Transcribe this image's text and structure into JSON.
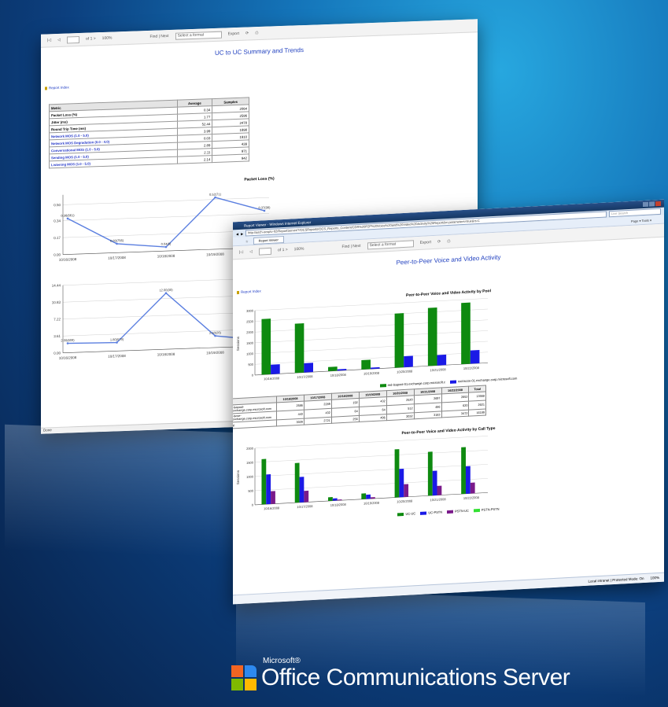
{
  "colors": {
    "accent_blue": "#1f3fbf",
    "green_series": "#0e8a10",
    "blue_series": "#1a1ae6",
    "line_color": "#5b7fe0"
  },
  "toolbar": {
    "page_of": "of 1 >",
    "zoom": "100%",
    "find_next": "Find | Next",
    "select_format": "Select a format",
    "export": "Export"
  },
  "report1": {
    "title": "UC to UC Summary and Trends",
    "report_index": "Report Index",
    "table": {
      "headers": [
        "Metric",
        "Average",
        "Samples"
      ],
      "rows": [
        [
          "Packet Loss (%)",
          "0.34",
          "2064"
        ],
        [
          "Jitter (ms)",
          "1.77",
          "2596"
        ],
        [
          "Round Trip Time (ms)",
          "52.44",
          "2478"
        ],
        [
          "Network MOS (1.0 - 5.0)",
          "3.99",
          "1898"
        ],
        [
          "Network MOS Degradation (0.0 - 4.0)",
          "0.03",
          "1910"
        ],
        [
          "Conversational MOS (1.0 - 5.0)",
          "2.89",
          "439"
        ],
        [
          "Sending MOS (1.0 - 5.0)",
          "2.11",
          "971"
        ],
        [
          "Listening MOS (1.0 - 5.0)",
          "2.14",
          "942"
        ]
      ]
    },
    "status": "Done"
  },
  "chart_data": [
    {
      "type": "line",
      "title": "Packet Loss (%)",
      "categories": [
        "10/16/2008",
        "10/17/2008",
        "10/18/2008",
        "10/19/2008",
        "10/20/2008"
      ],
      "values": [
        0.36,
        0.09,
        0.04,
        0.52,
        0.37
      ],
      "data_labels": [
        "0.36(661)",
        "0.09(756)",
        "0.04(6)",
        "0.52(71)",
        "0.37(98)"
      ],
      "yticks": [
        "0.50",
        "0.34",
        "0.17",
        "0.00"
      ],
      "ylim": [
        0,
        0.6
      ]
    },
    {
      "type": "line",
      "title": "Jitter (ms)",
      "categories": [
        "10/16/2008",
        "10/17/2008",
        "10/18/2008",
        "10/19/2008",
        "10/20/2008"
      ],
      "values": [
        2.0,
        1.8,
        12.0,
        2.5,
        1.2
      ],
      "data_labels": [
        "2.00(609)",
        "1.80(579)",
        "12.00(30)",
        "2.50(26)",
        "1.00(450)"
      ],
      "yticks": [
        "14.44",
        "10.83",
        "7.22",
        "3.61",
        "0.00"
      ],
      "ylim": [
        0,
        14.44
      ]
    },
    {
      "type": "bar",
      "title": "Peer-to-Peer Voice and Video Activity by Pool",
      "ylabel": "Sessions",
      "categories": [
        "10/16/2008",
        "10/17/2008",
        "10/18/2008",
        "10/19/2008",
        "10/20/2008",
        "10/21/2008",
        "10/22/2008"
      ],
      "series": [
        {
          "name": "red-lsapool-01.exchange.corp.microsoft.c",
          "values": [
            2586,
            2289,
            192,
            432,
            2520,
            2697,
            2852
          ]
        },
        {
          "name": "red-lscse-01.exchange.corp.microsoft.com",
          "values": [
            443,
            432,
            64,
            64,
            512,
            486,
            620
          ]
        }
      ],
      "yticks": [
        "3000",
        "2500",
        "2000",
        "1500",
        "1000",
        "500",
        "0"
      ],
      "ylim": [
        0,
        3000
      ]
    },
    {
      "type": "bar",
      "title": "Peer-to-Peer Voice and Video Activity by Call Type",
      "ylabel": "Sessions",
      "categories": [
        "10/16/2008",
        "10/17/2008",
        "10/18/2008",
        "10/19/2008",
        "10/20/2008",
        "10/21/2008",
        "10/22/2008"
      ],
      "series": [
        {
          "name": "UC-UC",
          "values": [
            1600,
            1400,
            130,
            200,
            1700,
            1550,
            1650
          ]
        },
        {
          "name": "UC-PSTN",
          "values": [
            1050,
            900,
            80,
            150,
            1000,
            870,
            970
          ]
        },
        {
          "name": "PSTN-UC",
          "values": [
            450,
            400,
            30,
            50,
            450,
            330,
            380
          ]
        },
        {
          "name": "PSTN-PSTN",
          "values": [
            0,
            0,
            0,
            0,
            0,
            0,
            0
          ]
        }
      ],
      "yticks": [
        "2000",
        "1500",
        "1000",
        "500",
        "0"
      ],
      "ylim": [
        0,
        2000
      ]
    }
  ],
  "report2": {
    "window_title": "Report Viewer - Windows Internet Explorer",
    "url": "http://asch-ocsptv-02/ReportServer/?/OCSReports/OCS_Reports_Content/CDR%20P2P%20Voice%20and%20Video%20Activity%20Report&rc:parameters=true&rs:C",
    "search_placeholder": "Live Search",
    "tab_label": "Report Viewer",
    "tools": "Page ▾ Tools ▾",
    "title": "Peer-to-Peer Voice and Video Activity",
    "report_index": "Report Index",
    "table": {
      "headers": [
        "",
        "10/16/2008",
        "10/17/2008",
        "10/18/2008",
        "10/19/2008",
        "10/20/2008",
        "10/21/2008",
        "10/22/2008",
        "Total"
      ],
      "rows": [
        [
          "red-lsapool-01.exchange.corp.microsoft.com",
          "2586",
          "2289",
          "192",
          "432",
          "2520",
          "2697",
          "2852",
          "13568"
        ],
        [
          "red-lscse-01.exchange.corp.microsoft.com",
          "443",
          "432",
          "64",
          "64",
          "512",
          "486",
          "620",
          "2621"
        ],
        [
          "Total",
          "3029",
          "2721",
          "256",
          "496",
          "3032",
          "3183",
          "3472",
          "16189"
        ]
      ]
    },
    "status_zone": "Local intranet | Protected Mode: On",
    "status_zoom": "100%"
  },
  "logo": {
    "microsoft": "Microsoft®",
    "product": "Office Communications Server"
  }
}
